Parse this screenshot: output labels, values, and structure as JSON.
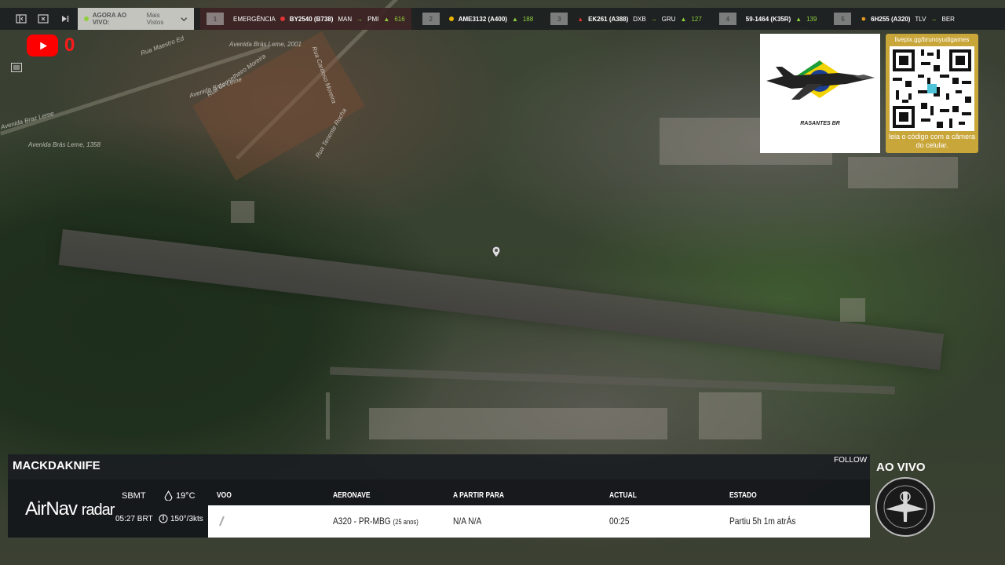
{
  "topbar": {
    "now_live_label": "AGORA AO VIVO:",
    "now_live_value": "Mais Vistos",
    "ticker": [
      {
        "num": "1",
        "title": "EMERGÊNCIA",
        "flight": "BY2540 (B738)",
        "route_from": "MAN",
        "route_to": "PMI",
        "count": "616"
      },
      {
        "num": "2",
        "flight": "AME3132 (A400)",
        "count": "188"
      },
      {
        "num": "3",
        "flight": "EK261 (A388)",
        "route_from": "DXB",
        "route_to": "GRU",
        "count": "127"
      },
      {
        "num": "4",
        "flight": "59-1464 (K35R)",
        "count": "139"
      },
      {
        "num": "5",
        "flight": "6H255 (A320)",
        "route_from": "TLV",
        "route_to": "BER"
      }
    ]
  },
  "youtube": {
    "count": "0"
  },
  "map_labels": {
    "l1": "Avenida Brás Leme, 2001",
    "l2": "Avenida Brás Leme",
    "l3": "Avenida Brás Leme, 1358",
    "l4": "Rua Maestro Ed",
    "l5": "Rua Conselheiro Moreira",
    "l6": "Rua Tenente Rocha",
    "l7": "Rua Cardoso Moreira",
    "l8": "Avenida Braz Leme"
  },
  "logo": {
    "caption": "RASANTES BR"
  },
  "qr": {
    "url": "livepix.gg/brunoyudigames",
    "caption": "leia o código com a câmera do celular."
  },
  "panel": {
    "callsign": "MACKDAKNIFE",
    "follow": "FOLLOW",
    "brand_main": "AirNav",
    "brand_sub": "radar",
    "airport": "SBMT",
    "time": "05:27 BRT",
    "temperature": "19°C",
    "wind": "150°/3kts",
    "headers": {
      "voo": "VOO",
      "aeronave": "AERONAVE",
      "partir": "A PARTIR PARA",
      "actual": "ACTUAL",
      "estado": "ESTADO"
    },
    "row": {
      "aircraft": "A320 - PR-MBG",
      "age": "(25 anos)",
      "route": "N/A N/A",
      "actual": "00:25",
      "status": "Partiu 5h 1m atrÁs"
    }
  },
  "ao_vivo": "AO VIVO",
  "colors": {
    "accent_green": "#8fcf3c",
    "youtube_red": "#ff0000",
    "qr_gold": "#c9a63a"
  }
}
